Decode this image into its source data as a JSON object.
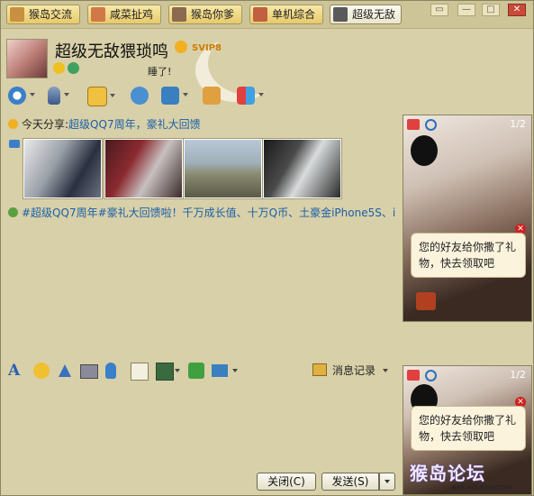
{
  "tabs": [
    {
      "label": "猴岛交流",
      "icon": "group-icon"
    },
    {
      "label": "咸菜扯鸡",
      "icon": "group-icon"
    },
    {
      "label": "猴岛你爹",
      "icon": "group-icon"
    },
    {
      "label": "单机综合",
      "icon": "group-icon"
    },
    {
      "label": "超级无敌",
      "icon": "user-avatar-icon"
    }
  ],
  "window_controls": {
    "restore": "▭",
    "minimize": "—",
    "maximize": "□",
    "close": "✕"
  },
  "profile": {
    "nickname": "超级无敌猥琐鸣",
    "badge": "SVIP8",
    "status_text": "睡了!"
  },
  "share": {
    "label": "今天分享:",
    "link": "超级QQ7周年，豪礼大回馈"
  },
  "topic": "#超级QQ7周年#豪礼大回馈啦！千万成长值、十万Q币、土豪金iPhone5S、iP...",
  "ad": {
    "page": "1/2",
    "bubble_text": "您的好友给你撒了礼物，快去领取吧"
  },
  "history_label": "消息记录",
  "buttons": {
    "close": "关闭(C)",
    "send": "发送(S)"
  },
  "watermark": "猴岛论坛",
  "watermark_url": "BBS.HOUDAO.COM",
  "colors": {
    "window_bg": "#d8d0a8",
    "link": "#1a5fa8",
    "tab_active": "#f3efde"
  }
}
